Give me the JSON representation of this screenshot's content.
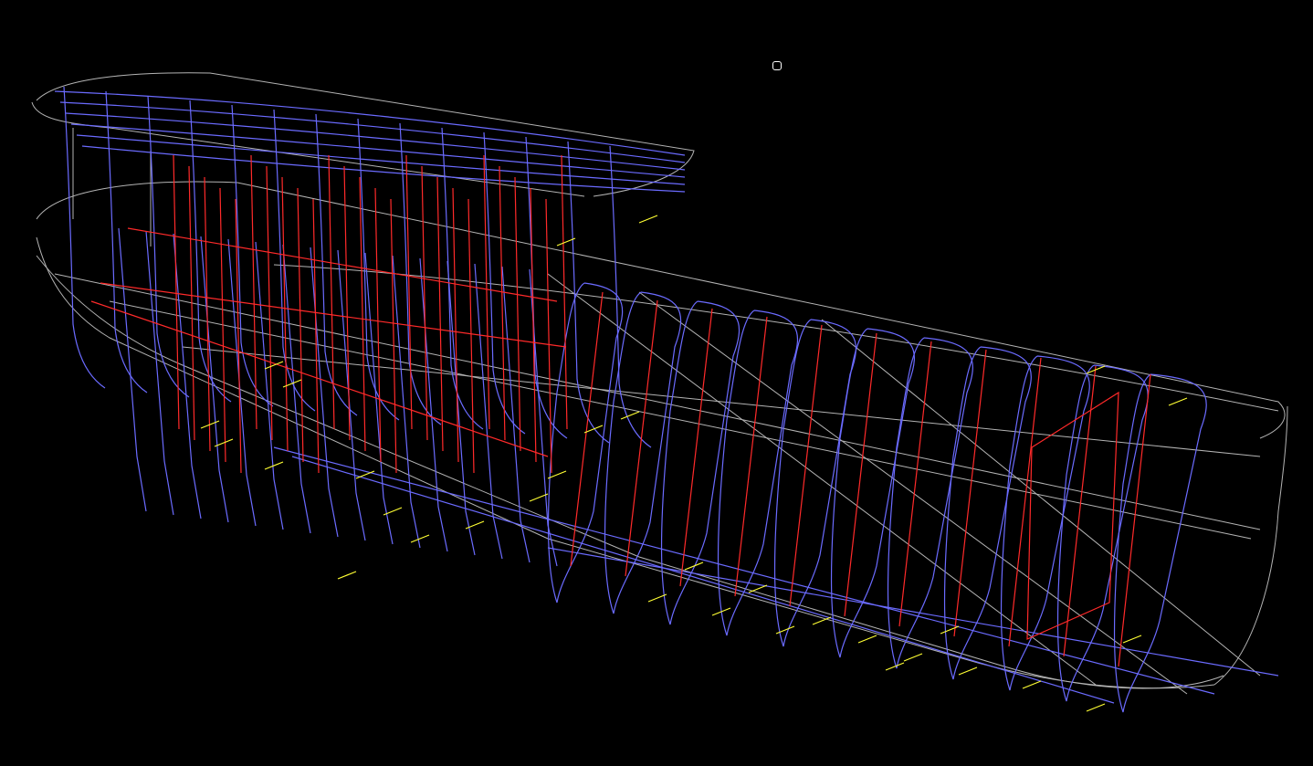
{
  "view": {
    "background": "#000000",
    "mode": "wireframe-3d",
    "subject": "ship-hull-structure"
  },
  "colors": {
    "hull_outline": "#b4b4b4",
    "frames": "#6b6bff",
    "stiffeners": "#ff2a2a",
    "annotations": "#ffff33",
    "labels": "#c8a060"
  },
  "layers": [
    {
      "name": "hull-outline",
      "color": "#b4b4b4"
    },
    {
      "name": "frames",
      "color": "#6b6bff"
    },
    {
      "name": "stiffeners",
      "color": "#ff2a2a"
    },
    {
      "name": "annotations",
      "color": "#ffff33"
    }
  ],
  "icons": {
    "ucs_marker": "cursor-marker-icon"
  }
}
